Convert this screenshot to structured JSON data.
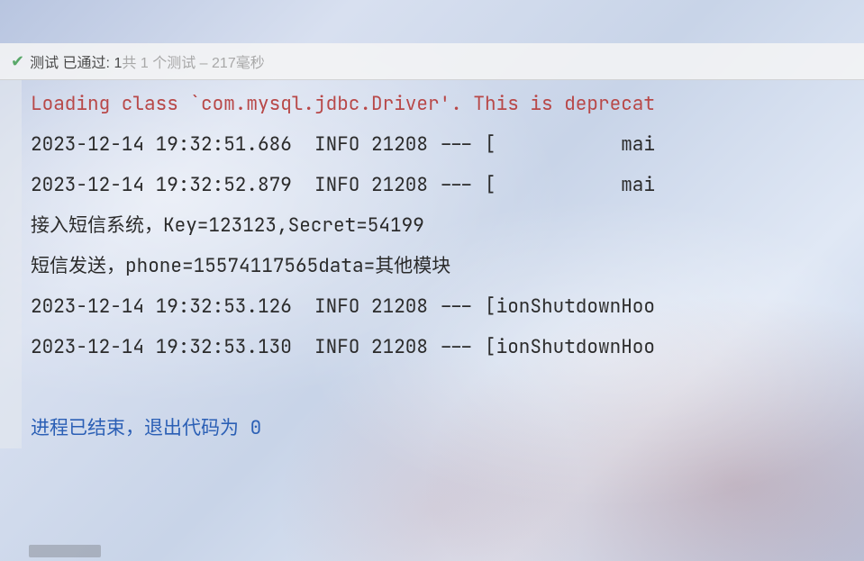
{
  "status": {
    "label_prefix": "测试 已通过:",
    "passed_count": "1",
    "middle_text": "共",
    "total_count": "1",
    "tests_word": "个测试",
    "separator": "–",
    "duration": "217毫秒"
  },
  "console": {
    "lines": [
      {
        "cls": "line-red",
        "text": "Loading class `com.mysql.jdbc.Driver'. This is deprecat"
      },
      {
        "cls": "",
        "text": "2023-12-14 19:32:51.686  INFO 21208 --- [           mai"
      },
      {
        "cls": "",
        "text": "2023-12-14 19:32:52.879  INFO 21208 --- [           mai"
      },
      {
        "cls": "",
        "text": "接入短信系统，Key=123123,Secret=54199"
      },
      {
        "cls": "",
        "text": "短信发送，phone=15574117565data=其他模块"
      },
      {
        "cls": "",
        "text": "2023-12-14 19:32:53.126  INFO 21208 --- [ionShutdownHoo"
      },
      {
        "cls": "",
        "text": "2023-12-14 19:32:53.130  INFO 21208 --- [ionShutdownHoo"
      },
      {
        "cls": "",
        "text": ""
      },
      {
        "cls": "line-blue",
        "text": "进程已结束，退出代码为 0"
      }
    ]
  }
}
